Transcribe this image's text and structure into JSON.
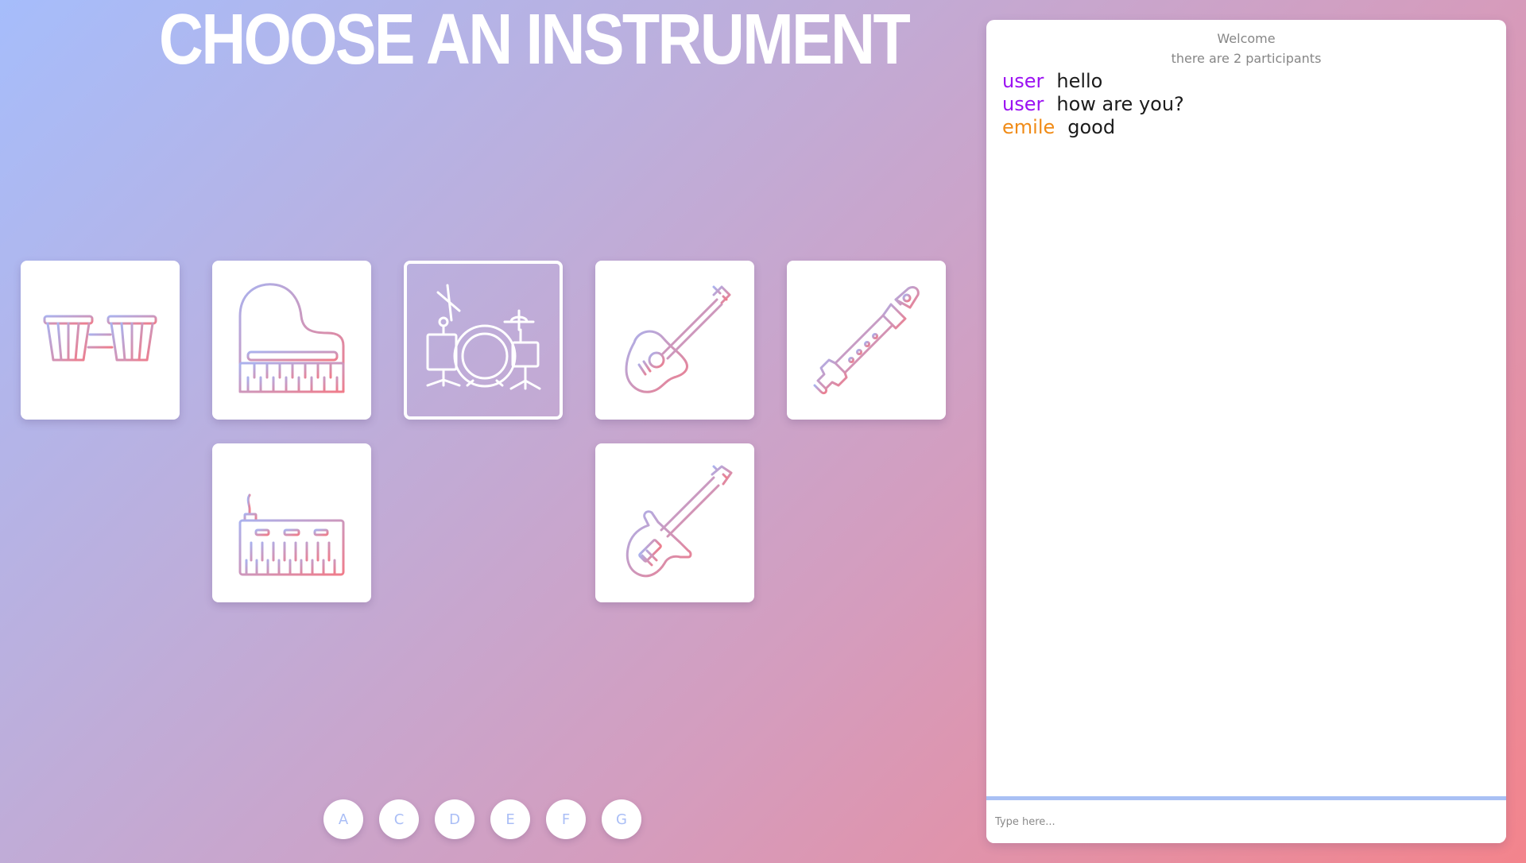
{
  "page": {
    "title": "CHOOSE AN INSTRUMENT"
  },
  "instruments": [
    {
      "icon": "bongo-drums-icon",
      "selected": false
    },
    {
      "icon": "grand-piano-icon",
      "selected": false
    },
    {
      "icon": "drum-kit-icon",
      "selected": true
    },
    {
      "icon": "acoustic-guitar-icon",
      "selected": false
    },
    {
      "icon": "recorder-flute-icon",
      "selected": false
    },
    {
      "icon": "synthesizer-keyboard-icon",
      "selected": false
    },
    {
      "icon": "electric-guitar-icon",
      "selected": false
    }
  ],
  "notes": [
    "A",
    "C",
    "D",
    "E",
    "F",
    "G"
  ],
  "chat": {
    "welcome": "Welcome",
    "participants": "there are 2 participants",
    "messages": [
      {
        "user": "user",
        "text": "hello",
        "color": "#9b11f2"
      },
      {
        "user": "user",
        "text": "how are you?",
        "color": "#9b11f2"
      },
      {
        "user": "emile",
        "text": "good",
        "color": "#f08b17"
      }
    ],
    "input_placeholder": "Type here..."
  },
  "colors": {
    "gradient_start": "#a6bdfb",
    "gradient_end": "#f3848c",
    "icon_gradient_start": "#aab2ee",
    "icon_gradient_end": "#f07c8a",
    "note_text": "#aabef6",
    "chat_divider": "#a9c0f4"
  }
}
